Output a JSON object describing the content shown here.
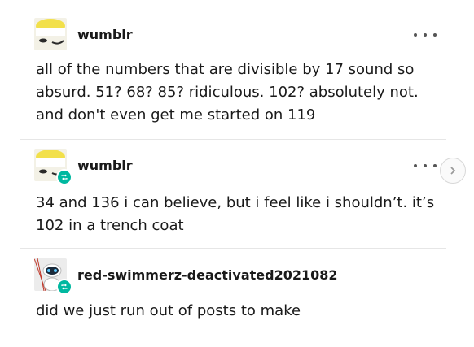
{
  "posts": [
    {
      "username": "wumblr",
      "body": "all of the numbers that are divisible by 17 sound so absurd. 51? 68? 85? ridiculous. 102? absolutely not. and don't even get me started on 119",
      "avatar_icon": "cartoon-face-avatar",
      "reblogged": false
    },
    {
      "username": "wumblr",
      "body": "34 and 136 i can believe, but i feel like i shouldn’t. it’s 102 in a trench coat",
      "avatar_icon": "cartoon-face-avatar",
      "reblogged": true
    },
    {
      "username": "red-swimmerz-deactivated2021082",
      "body": "did we just run out of posts to make",
      "avatar_icon": "robot-avatar",
      "reblogged": true
    }
  ],
  "colors": {
    "text": "#1a1a1a",
    "reblog_badge": "#00b8a0",
    "divider": "#e6e6e6"
  }
}
